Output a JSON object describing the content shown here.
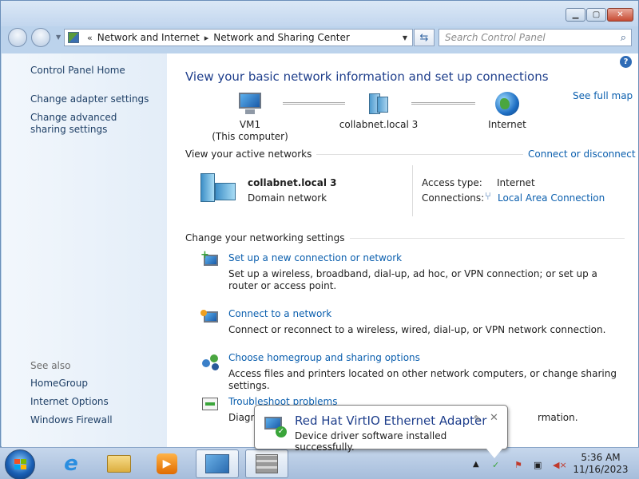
{
  "address_bar": {
    "crumb_prefix": "«",
    "crumbs": [
      "Network and Internet",
      "Network and Sharing Center"
    ],
    "search_placeholder": "Search Control Panel"
  },
  "sidebar": {
    "links": [
      "Control Panel Home",
      "Change adapter settings",
      "Change advanced sharing settings"
    ],
    "see_also_label": "See also",
    "see_also": [
      "HomeGroup",
      "Internet Options",
      "Windows Firewall"
    ]
  },
  "main": {
    "heading": "View your basic network information and set up connections",
    "see_full_map": "See full map",
    "map": {
      "computer_name": "VM1",
      "computer_sub": "(This computer)",
      "network_name": "collabnet.local  3",
      "internet": "Internet"
    },
    "active_networks_title": "View your active networks",
    "connect_disconnect": "Connect or disconnect",
    "active_network": {
      "name": "collabnet.local  3",
      "type": "Domain network",
      "access_type_label": "Access type:",
      "access_type_value": "Internet",
      "connections_label": "Connections:",
      "connections_value": "Local Area Connection"
    },
    "settings_title": "Change your networking settings",
    "tasks": [
      {
        "title": "Set up a new connection or network",
        "desc": "Set up a wireless, broadband, dial-up, ad hoc, or VPN connection; or set up a router or access point."
      },
      {
        "title": "Connect to a network",
        "desc": "Connect or reconnect to a wireless, wired, dial-up, or VPN network connection."
      },
      {
        "title": "Choose homegroup and sharing options",
        "desc": "Access files and printers located on other network computers, or change sharing settings."
      },
      {
        "title": "Troubleshoot problems",
        "desc_start": "Diagno",
        "desc_end": "rmation."
      }
    ]
  },
  "balloon": {
    "title": "Red Hat VirtIO Ethernet Adapter",
    "text": "Device driver software installed successfully."
  },
  "taskbar": {
    "time": "5:36 AM",
    "date": "11/16/2023"
  },
  "colors": {
    "link": "#0b5fae",
    "heading": "#1f3f8c",
    "sidebar_bg": "#e8f0f9"
  }
}
